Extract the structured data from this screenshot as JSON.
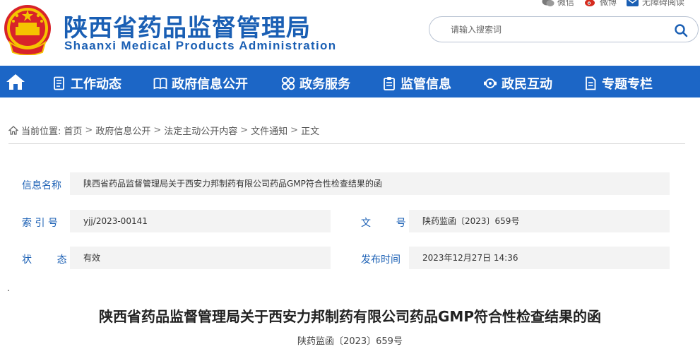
{
  "topbar": {
    "wechat": "微信",
    "weibo": "微博",
    "accessible": "无障碍阅读"
  },
  "header": {
    "cn_title": "陕西省药品监督管理局",
    "en_title": "Shaanxi Medical Products Administration",
    "search_placeholder": "请输入搜索词"
  },
  "nav": {
    "items": [
      {
        "label": "工作动态",
        "icon": "document-list-icon"
      },
      {
        "label": "政府信息公开",
        "icon": "book-icon"
      },
      {
        "label": "政务服务",
        "icon": "grid-circles-icon"
      },
      {
        "label": "监管信息",
        "icon": "clipboard-icon"
      },
      {
        "label": "政民互动",
        "icon": "interaction-icon"
      },
      {
        "label": "专题专栏",
        "icon": "file-icon"
      }
    ]
  },
  "breadcrumb": {
    "prefix": "当前位置:",
    "items": [
      "首页",
      "政府信息公开",
      "法定主动公开内容",
      "文件通知",
      "正文"
    ]
  },
  "info": {
    "name_label": "信息名称",
    "name_value": "陕西省药品监督管理局关于西安力邦制药有限公司药品GMP符合性检查结果的函",
    "index_label": "索 引 号",
    "index_value": "yjj/2023-00141",
    "docno_label": "文        号",
    "docno_value": "陕药监函〔2023〕659号",
    "status_label": "状        态",
    "status_value": "有效",
    "date_label": "发布时间",
    "date_value": "2023年12月27日 14:36"
  },
  "stray_dot": ".",
  "document": {
    "title": "陕西省药品监督管理局关于西安力邦制药有限公司药品GMP符合性检查结果的函",
    "number": "陕药监函〔2023〕659号"
  },
  "colors": {
    "brand_blue": "#1a5fb4",
    "nav_blue": "#1c66c6",
    "field_bg": "#f3f3f3"
  }
}
